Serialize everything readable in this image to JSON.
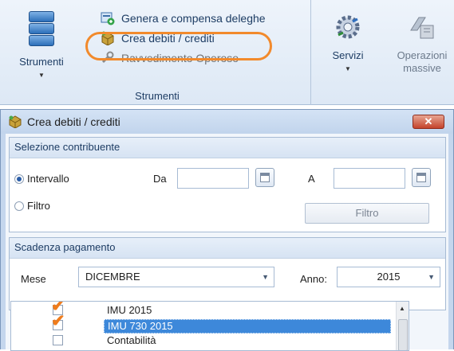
{
  "ribbon": {
    "strumenti_button": "Strumenti",
    "items": [
      {
        "label": "Genera e compensa deleghe",
        "icon": "generate-icon",
        "enabled": true
      },
      {
        "label": "Crea debiti / crediti",
        "icon": "box-icon",
        "enabled": true
      },
      {
        "label": "Ravvedimento Operoso",
        "icon": "wrench-icon",
        "enabled": false
      }
    ],
    "group_caption": "Strumenti",
    "servizi_button": "Servizi",
    "operazioni_button_line1": "Operazioni",
    "operazioni_button_line2": "massive",
    "highlight_color": "#f28a2c"
  },
  "dialog": {
    "title": "Crea debiti / crediti",
    "close_glyph": "✕",
    "selezione": {
      "header": "Selezione contribuente",
      "radio_intervallo": "Intervallo",
      "radio_filtro": "Filtro",
      "da_label": "Da",
      "a_label": "A",
      "da_value": "",
      "a_value": "",
      "filtro_button": "Filtro",
      "selected": "Intervallo"
    },
    "scadenza": {
      "header": "Scadenza pagamento",
      "mese_label": "Mese",
      "mese_value": "DICEMBRE",
      "anno_label": "Anno:",
      "anno_value": "2015"
    },
    "list_items": [
      {
        "label": "IMU 2015",
        "checked": true,
        "selected": false
      },
      {
        "label": "IMU 730 2015",
        "checked": true,
        "selected": true
      },
      {
        "label": "Contabilità",
        "checked": false,
        "selected": false
      }
    ],
    "selection_color": "#3d88da",
    "check_color": "#ef7c1c"
  }
}
